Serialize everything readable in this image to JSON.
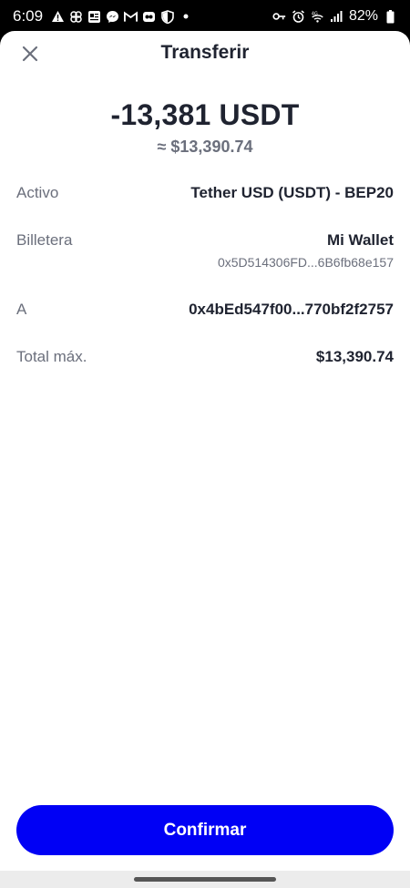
{
  "status_bar": {
    "time": "6:09",
    "battery": "82%",
    "left_icons": [
      "alert-icon",
      "pinwheel-icon",
      "news-icon",
      "messenger-icon",
      "gmail-icon",
      "app-icon",
      "shield-icon",
      "dot-icon"
    ],
    "right_icons": [
      "key-icon",
      "alarm-icon",
      "wifi-4g-icon",
      "signal-icon",
      "battery-icon"
    ]
  },
  "header": {
    "title": "Transferir",
    "close_icon": "close-icon"
  },
  "summary": {
    "amount": "-13,381 USDT",
    "fiat": "≈ $13,390.74"
  },
  "details": {
    "asset_label": "Activo",
    "asset_value": "Tether USD (USDT) - BEP20",
    "wallet_label": "Billetera",
    "wallet_name": "Mi Wallet",
    "wallet_address": "0x5D514306FD...6B6fb68e157",
    "to_label": "A",
    "to_address": "0x4bEd547f00...770bf2f2757",
    "total_label": "Total máx.",
    "total_value": "$13,390.74"
  },
  "actions": {
    "confirm_label": "Confirmar"
  },
  "colors": {
    "primary": "#0000f5",
    "text": "#1f2330",
    "muted": "#6b6f7c"
  }
}
